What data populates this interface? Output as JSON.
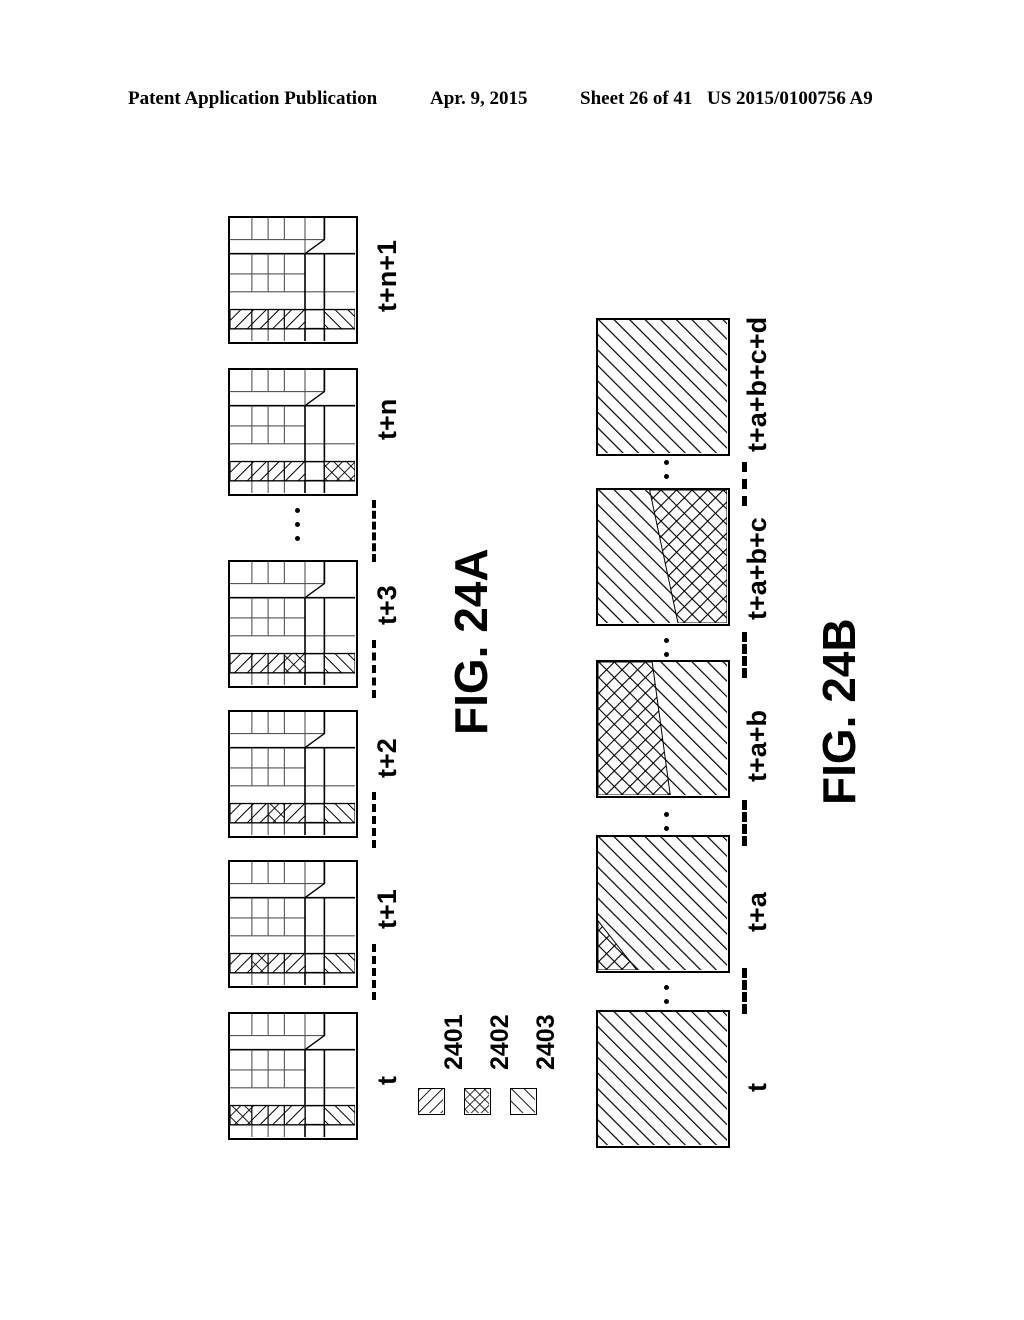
{
  "header": {
    "publication": "Patent Application Publication",
    "date": "Apr. 9, 2015",
    "sheet": "Sheet 26 of 41",
    "patent_number": "US 2015/0100756 A9"
  },
  "figures": [
    {
      "id": "fig-24a",
      "title": "FIG. 24A",
      "type": "grid-sequence",
      "description": "Sequence of spatially subdivided map grids over time showing propagation of a marked (cross-hatched) cell along a hatched row",
      "frames": [
        {
          "label": "t",
          "crosshatch_cell": 0
        },
        {
          "label": "t+1",
          "crosshatch_cell": 1
        },
        {
          "label": "t+2",
          "crosshatch_cell": 2
        },
        {
          "label": "t+3",
          "crosshatch_cell": 3
        },
        {
          "label": "t+n",
          "crosshatch_cell": 5
        },
        {
          "label": "t+n+1",
          "crosshatch_cell": -1
        }
      ]
    },
    {
      "id": "fig-24b",
      "title": "FIG. 24B",
      "type": "block-sequence",
      "description": "Sequence of solid region blocks over time showing a cross-hatched region growing then shrinking across the block",
      "frames": [
        {
          "label": "t",
          "pattern": "hatch-full"
        },
        {
          "label": "t+a",
          "pattern": "hatch-with-small-crosshatch-corner"
        },
        {
          "label": "t+a+b",
          "pattern": "crosshatch-left-hatch-right"
        },
        {
          "label": "t+a+b+c",
          "pattern": "hatch-left-crosshatch-right"
        },
        {
          "label": "t+a+b+c+d",
          "pattern": "hatch-full"
        }
      ]
    }
  ],
  "legend": {
    "items": [
      {
        "ref": "2401",
        "pattern": "diagonal-hatch-dense"
      },
      {
        "ref": "2402",
        "pattern": "cross-hatch"
      },
      {
        "ref": "2403",
        "pattern": "diagonal-hatch-sparse"
      }
    ]
  }
}
